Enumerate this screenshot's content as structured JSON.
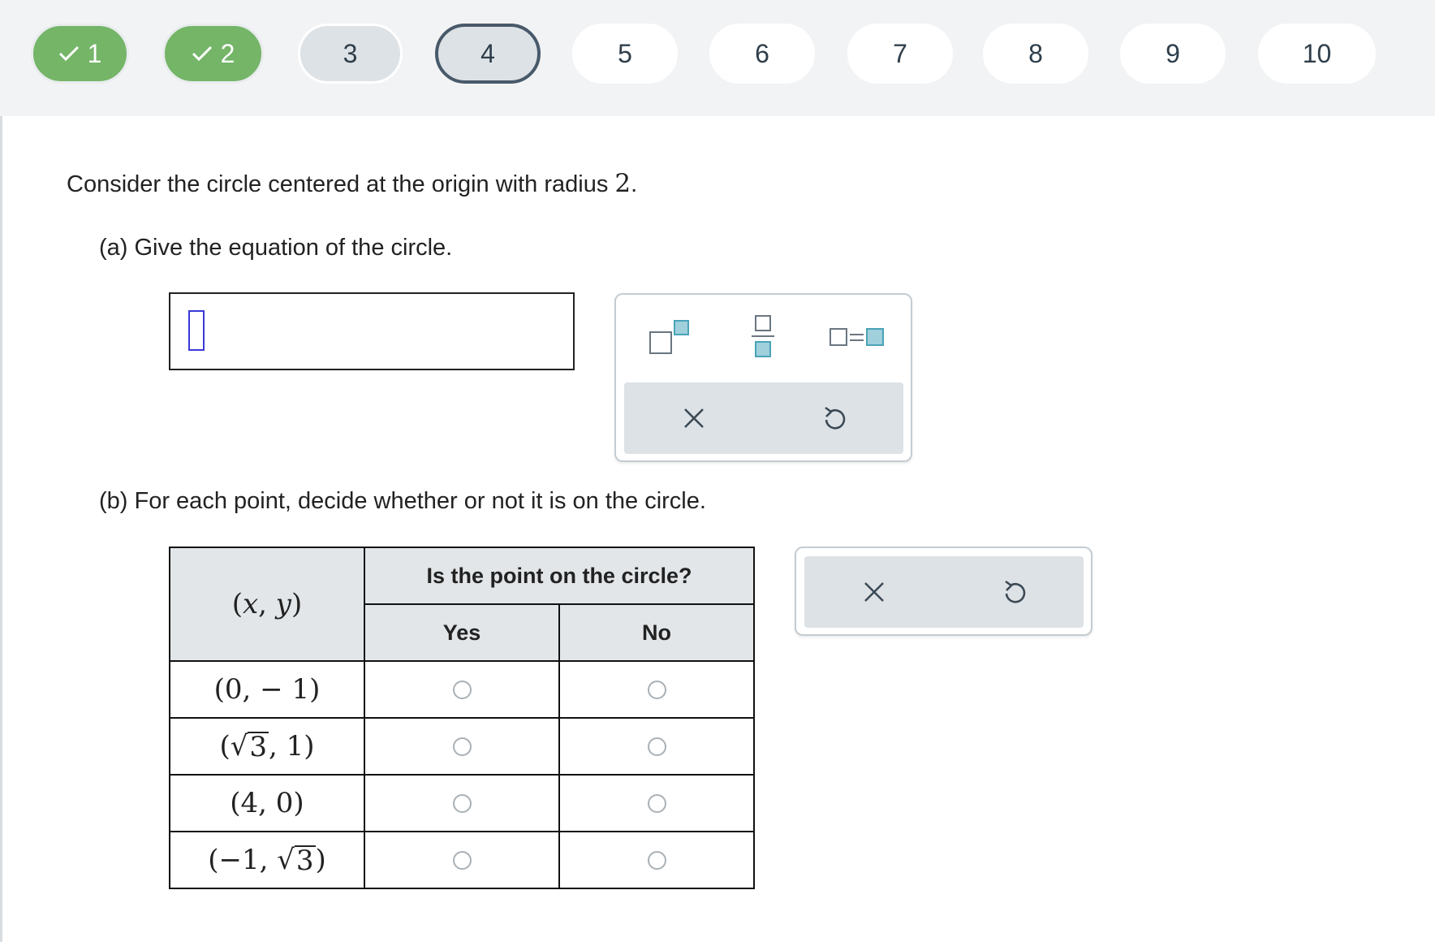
{
  "nav": {
    "items": [
      {
        "label": "1",
        "state": "done"
      },
      {
        "label": "2",
        "state": "done"
      },
      {
        "label": "3",
        "state": "visited"
      },
      {
        "label": "4",
        "state": "current"
      },
      {
        "label": "5",
        "state": "unvisited"
      },
      {
        "label": "6",
        "state": "unvisited"
      },
      {
        "label": "7",
        "state": "unvisited"
      },
      {
        "label": "8",
        "state": "unvisited"
      },
      {
        "label": "9",
        "state": "unvisited"
      },
      {
        "label": "10",
        "state": "unvisited"
      }
    ]
  },
  "question": {
    "stem_text": "Consider the circle centered at the origin with radius ",
    "radius": "2",
    "stem_end": ".",
    "part_a": "(a) Give the equation of the circle.",
    "part_b": "(b) For each point, decide whether or not it is on the circle."
  },
  "answer_input": {
    "value": ""
  },
  "palette": {
    "buttons": [
      "superscript-icon",
      "fraction-icon",
      "equals-icon"
    ],
    "actions": [
      "clear-icon",
      "undo-icon"
    ]
  },
  "table": {
    "header_xy": {
      "open": "(",
      "x": "x",
      "comma": ", ",
      "y": "y",
      "close": ")"
    },
    "header_group": "Is the point on the circle?",
    "col_yes": "Yes",
    "col_no": "No",
    "rows": [
      {
        "pre": "(0, − 1)",
        "selected": null
      },
      {
        "pre": "(",
        "radicand": "3",
        "post": ", 1)",
        "selected": null
      },
      {
        "pre": "(4, 0)",
        "selected": null
      },
      {
        "pre": "(−1, ",
        "radicand": "3",
        "post": ")",
        "selected": null
      }
    ]
  },
  "colors": {
    "done_green": "#74b568",
    "visited_gray": "#dde2e6",
    "current_border": "#48596a",
    "accent_teal": "#4aa3b8"
  }
}
